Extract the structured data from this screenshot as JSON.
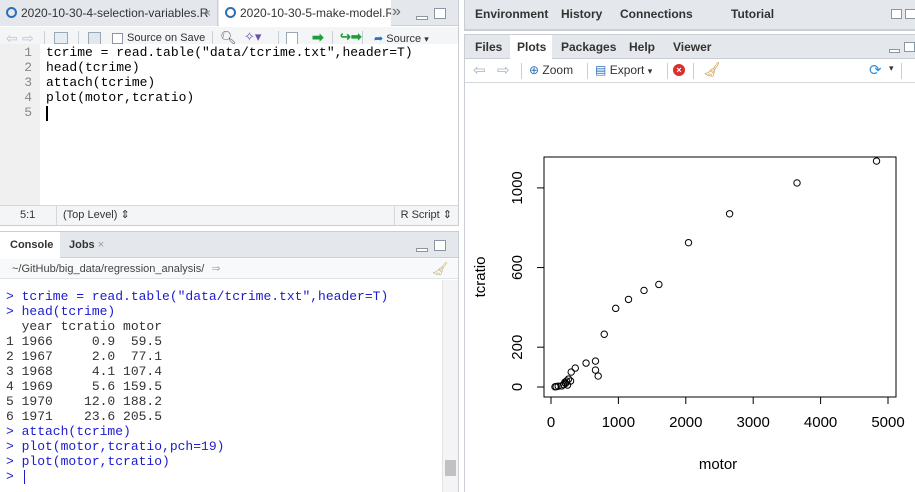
{
  "editor": {
    "tabs": [
      {
        "label": "2020-10-30-4-selection-variables.R",
        "close": "×"
      },
      {
        "label": "2020-10-30-5-make-model.R",
        "close": "×"
      }
    ],
    "more": "»",
    "toolbar": {
      "source_on_save": "Source on Save",
      "source": "Source"
    },
    "lines": [
      {
        "num": "1",
        "text": "tcrime = read.table(\"data/tcrime.txt\",header=T)"
      },
      {
        "num": "2",
        "text": "head(tcrime)"
      },
      {
        "num": "3",
        "text": "attach(tcrime)"
      },
      {
        "num": "4",
        "text": "plot(motor,tcratio)"
      },
      {
        "num": "5",
        "text": ""
      }
    ],
    "status": {
      "position": "5:1",
      "scope": "(Top Level)",
      "type": "R Script"
    }
  },
  "console": {
    "tabs": [
      "Console",
      "Jobs"
    ],
    "path": "~/GitHub/big_data/regression_analysis/",
    "lines": [
      "> tcrime = read.table(\"data/tcrime.txt\",header=T)",
      "> head(tcrime)",
      "  year tcratio motor",
      "1 1966     0.9  59.5",
      "2 1967     2.0  77.1",
      "3 1968     4.1 107.4",
      "4 1969     5.6 159.5",
      "5 1970    12.0 188.2",
      "6 1971    23.6 205.5",
      "> attach(tcrime)",
      "> plot(motor,tcratio,pch=19)",
      "> plot(motor,tcratio)",
      "> "
    ]
  },
  "env_pane": {
    "tabs": [
      "Environment",
      "History",
      "Connections",
      "Tutorial"
    ]
  },
  "files_pane": {
    "tabs": [
      "Files",
      "Plots",
      "Packages",
      "Help",
      "Viewer"
    ],
    "active_tab": "Plots",
    "toolbar": {
      "zoom": "Zoom",
      "export": "Export"
    }
  },
  "chart_data": {
    "type": "scatter",
    "xlabel": "motor",
    "ylabel": "tcratio",
    "xlim": [
      0,
      5000
    ],
    "ylim": [
      0,
      1100
    ],
    "xticks": [
      "0",
      "1000",
      "2000",
      "3000",
      "4000",
      "5000"
    ],
    "yticks": [
      "0",
      "200",
      "600",
      "1000"
    ],
    "ytick_values": [
      0,
      200,
      600,
      1000
    ],
    "grid": false,
    "points": [
      [
        59.5,
        0.9
      ],
      [
        77.1,
        2.0
      ],
      [
        107.4,
        4.1
      ],
      [
        159.5,
        5.6
      ],
      [
        188.2,
        12.0
      ],
      [
        205.5,
        23.6
      ],
      [
        215,
        18
      ],
      [
        230,
        30
      ],
      [
        245,
        10
      ],
      [
        260,
        40
      ],
      [
        290,
        30
      ],
      [
        300,
        75
      ],
      [
        360,
        95
      ],
      [
        520,
        120
      ],
      [
        660,
        130
      ],
      [
        660,
        85
      ],
      [
        700,
        55
      ],
      [
        790,
        265
      ],
      [
        960,
        395
      ],
      [
        1150,
        440
      ],
      [
        1380,
        485
      ],
      [
        1600,
        515
      ],
      [
        2040,
        725
      ],
      [
        2650,
        870
      ],
      [
        3650,
        1025
      ],
      [
        4830,
        1135
      ]
    ]
  }
}
